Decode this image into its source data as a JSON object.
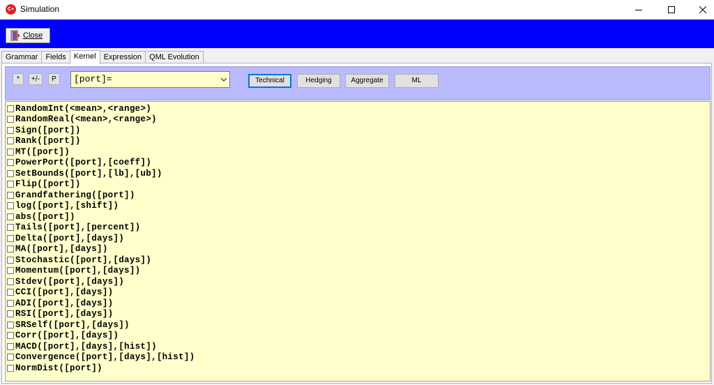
{
  "window": {
    "title": "Simulation",
    "icon": "app-logo-icon"
  },
  "toolbar": {
    "close_label": "Close"
  },
  "tabs": [
    {
      "label": "Grammar",
      "active": false
    },
    {
      "label": "Fields",
      "active": false
    },
    {
      "label": "Kernel",
      "active": true
    },
    {
      "label": "Expression",
      "active": false
    },
    {
      "label": "QML Evolution",
      "active": false
    }
  ],
  "controls": {
    "op_buttons": [
      "*",
      "+/-",
      "P"
    ],
    "expression_value": "[port]=",
    "categories": [
      "Technical",
      "Hedging",
      "Aggregate",
      "ML"
    ],
    "active_category": "Technical"
  },
  "functions": [
    "RandomInt(<mean>,<range>)",
    "RandomReal(<mean>,<range>)",
    "Sign([port])",
    "Rank([port])",
    "MT([port])",
    "PowerPort([port],[coeff])",
    "SetBounds([port],[lb],[ub])",
    "Flip([port])",
    "Grandfathering([port])",
    "log([port],[shift])",
    "abs([port])",
    "Tails([port],[percent])",
    "Delta([port],[days])",
    "MA([port],[days])",
    "Stochastic([port],[days])",
    "Momentum([port],[days])",
    "Stdev([port],[days])",
    "CCI([port],[days])",
    "ADI([port],[days])",
    "RSI([port],[days])",
    "SRSelf([port],[days])",
    "Corr([port],[days])",
    "MACD([port],[days],[hist])",
    "Convergence([port],[days],[hist])",
    "NormDist([port])"
  ],
  "colors": {
    "toolbar_band": "#0000ff",
    "control_strip": "#babaff",
    "list_background": "#ffffcc"
  }
}
